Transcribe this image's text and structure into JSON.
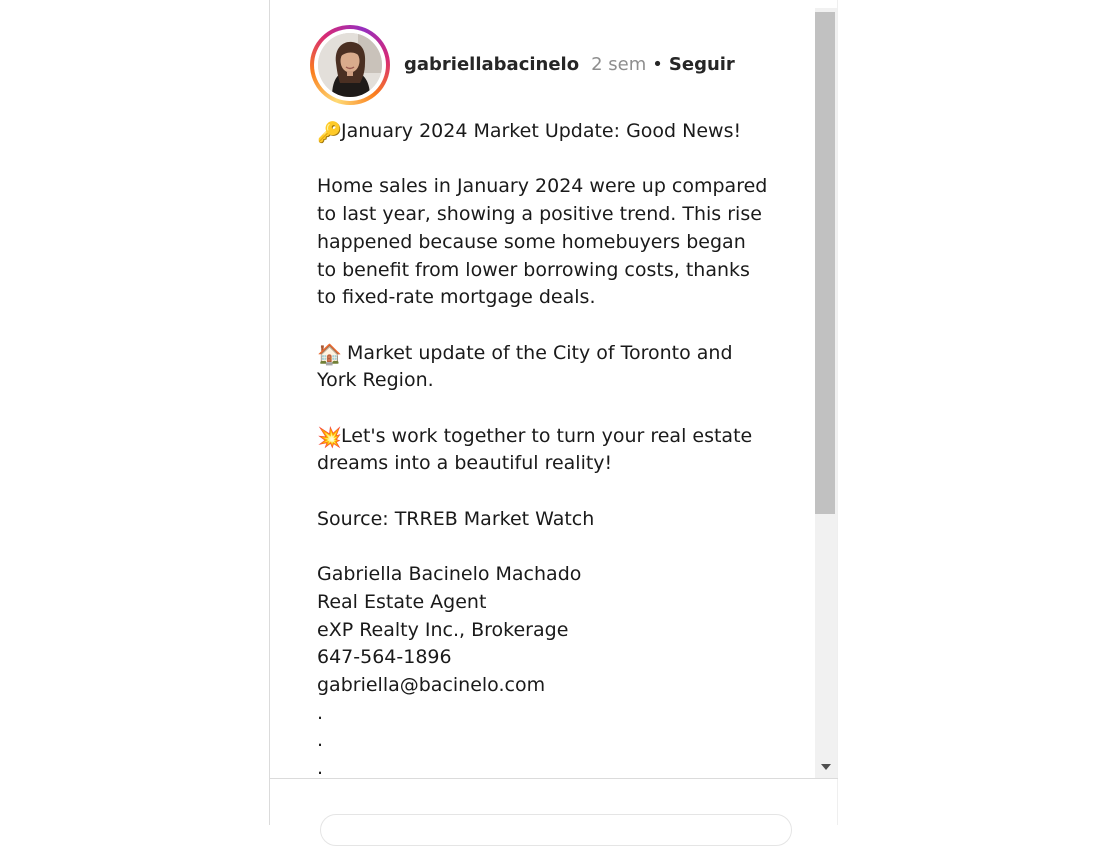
{
  "post": {
    "username": "gabriellabacinelo",
    "time": "2 sem",
    "separator": "•",
    "follow_label": "Seguir",
    "avatar_icon": "profile-photo-icon"
  },
  "caption": {
    "line1_emoji": "🔑",
    "line1_text": "January 2024 Market Update: Good News!",
    "p2": [
      "Home sales in January 2024 were up compared",
      "to last year, showing a positive trend. This rise",
      "happened because some homebuyers began",
      "to benefit from lower borrowing costs, thanks",
      "to fixed-rate mortgage deals."
    ],
    "p3_emoji": "🏠",
    "p3_line1": " Market update of the City of Toronto and",
    "p3_line2": "York Region.",
    "p4_emoji": "💥",
    "p4_line1": "Let's work together to turn your real estate",
    "p4_line2": "dreams into a beautiful reality!",
    "source": "Source: TRREB Market Watch",
    "signature": [
      "Gabriella Bacinelo Machado",
      "Real Estate Agent",
      "eXP Realty Inc., Brokerage",
      "647-564-1896",
      "gabriella@bacinelo.com"
    ],
    "dots": [
      ".",
      ".",
      "."
    ]
  },
  "colors": {
    "text": "#262626",
    "muted": "#8e8e8e",
    "story_ring": [
      "#feda75",
      "#fa7e1e",
      "#d62976",
      "#962fbf"
    ]
  }
}
